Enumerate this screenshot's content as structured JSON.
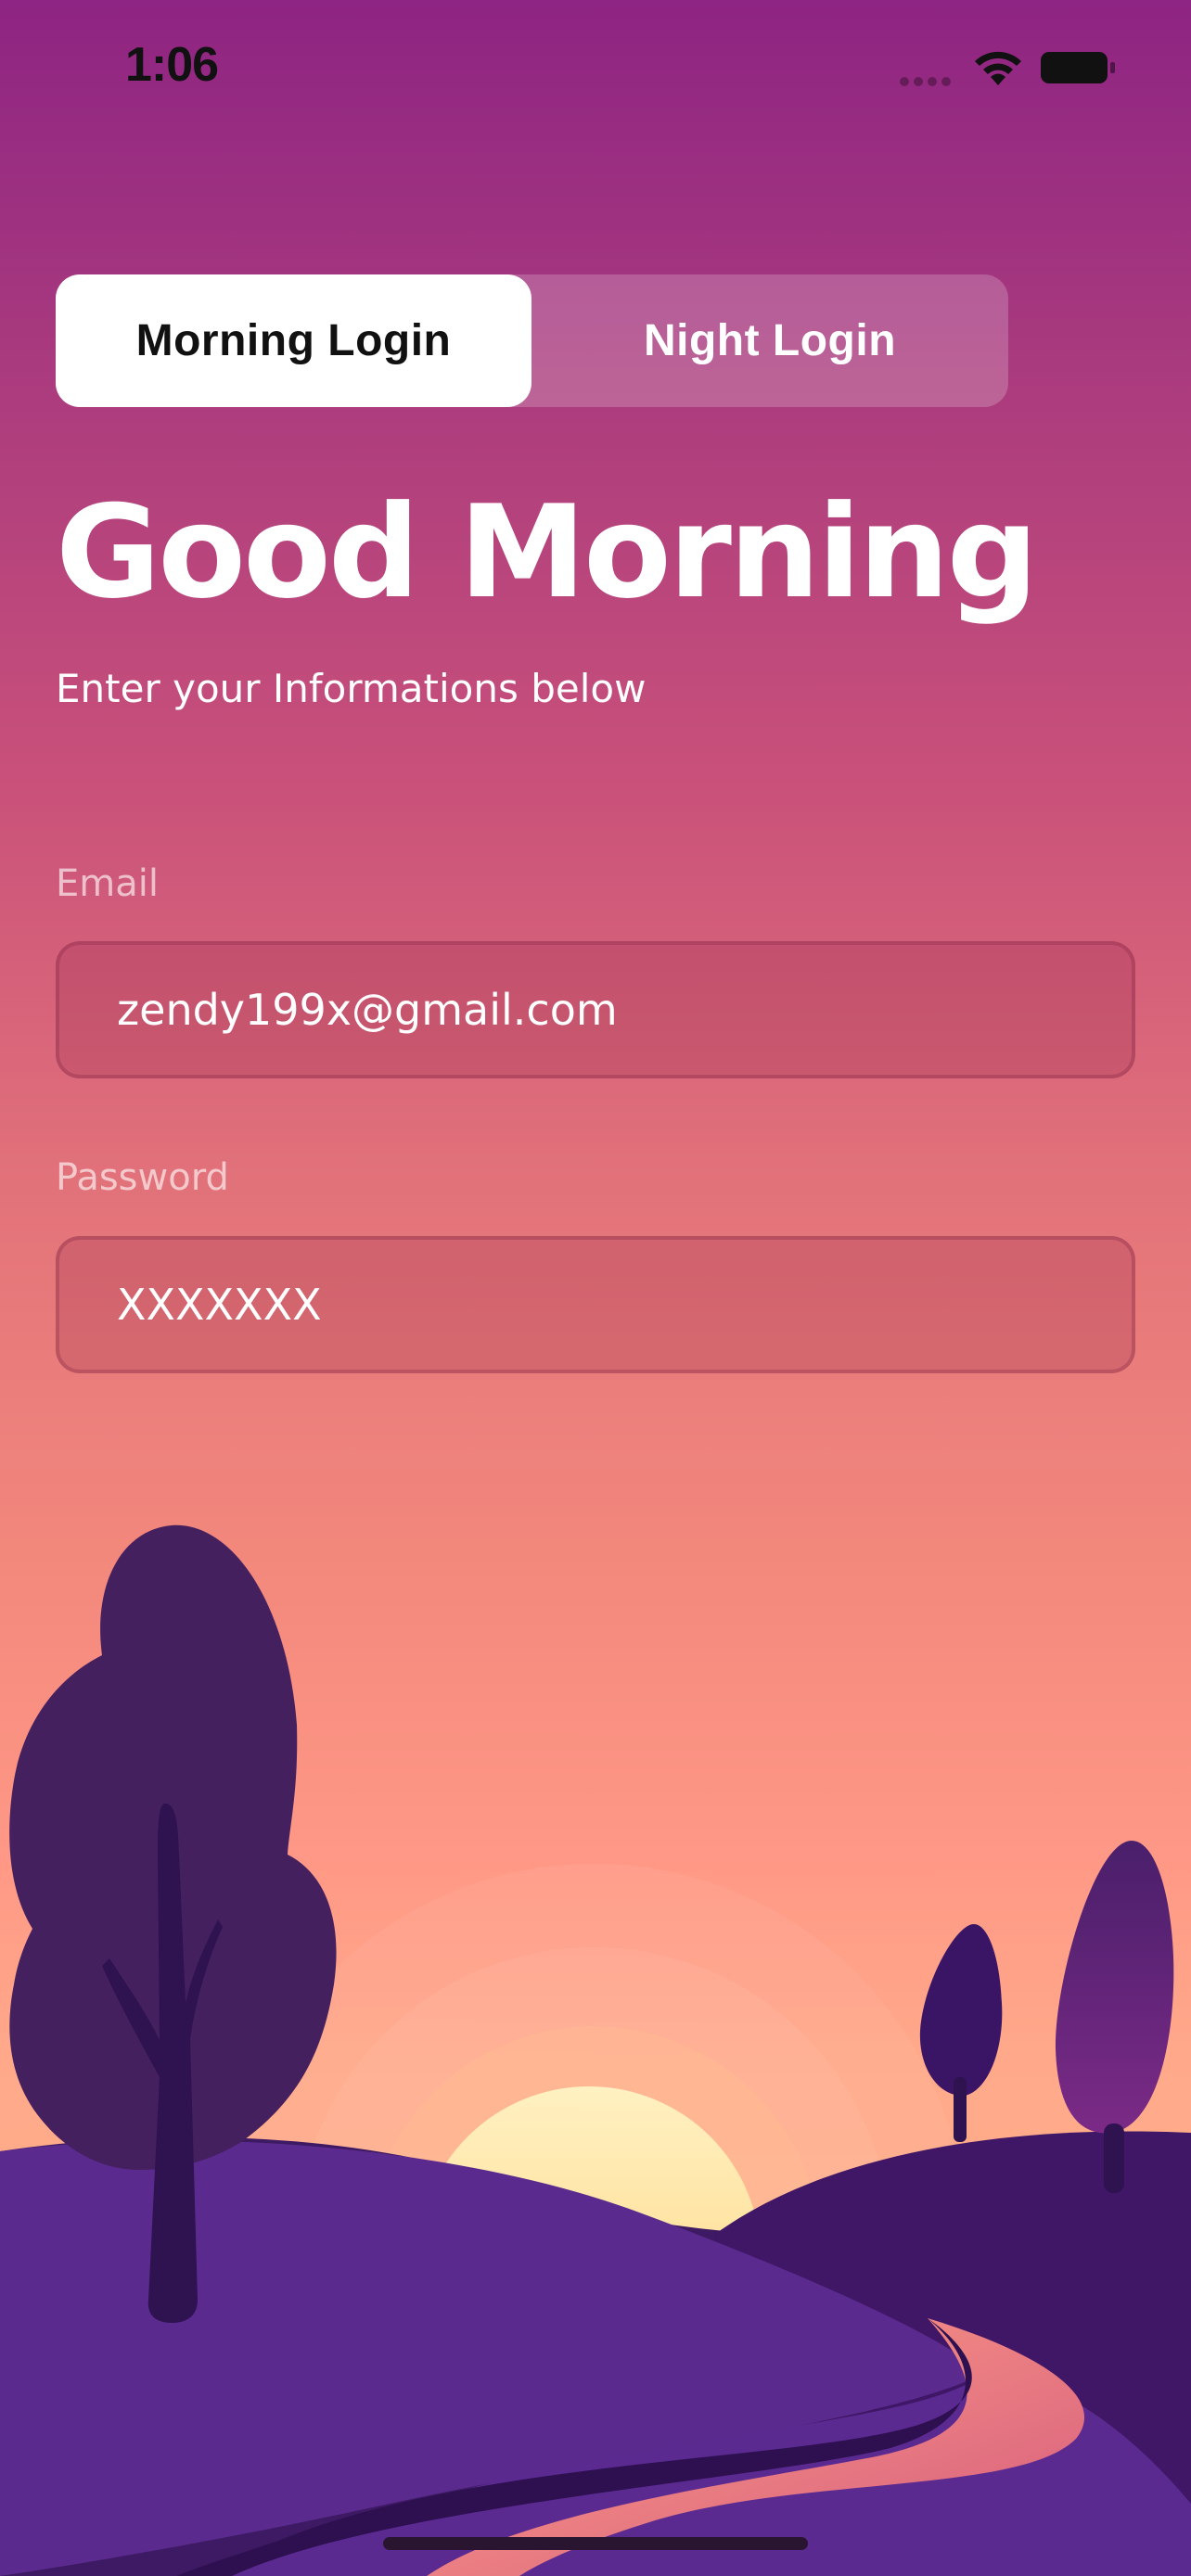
{
  "status_bar": {
    "time": "1:06"
  },
  "tabs": [
    {
      "label": "Morning Login",
      "active": true
    },
    {
      "label": "Night Login",
      "active": false
    }
  ],
  "greeting": {
    "title": "Good Morning",
    "subtitle": "Enter your Informations below"
  },
  "form": {
    "email": {
      "label": "Email",
      "value": "zendy199x@gmail.com"
    },
    "password": {
      "label": "Password",
      "value": "XXXXXXX"
    }
  },
  "colors": {
    "gradient_top": "#8e2483",
    "gradient_bottom": "#ffb68a",
    "hill": "#5b2a8e",
    "tree": "#45205e",
    "sun": "#ffe9a8"
  }
}
